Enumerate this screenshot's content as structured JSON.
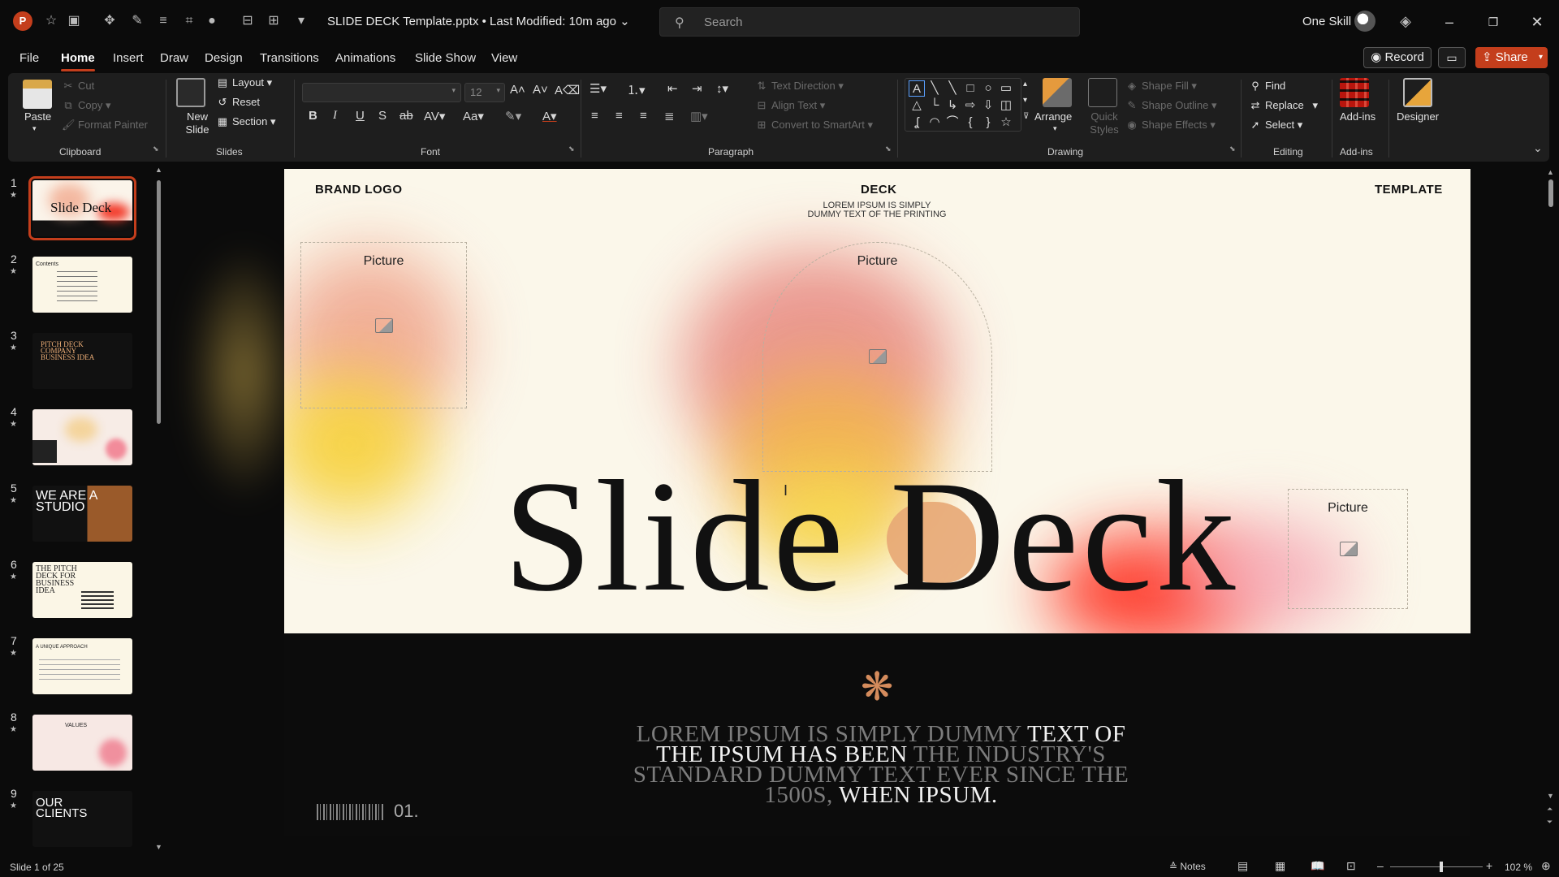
{
  "app": {
    "logo_letter": "P"
  },
  "titlebar": {
    "doc_title": "SLIDE DECK Template.pptx • Last Modified: 10m ago ⌄",
    "search_placeholder": "Search",
    "user_name": "One Skill"
  },
  "menu": {
    "tabs": [
      {
        "label": "File"
      },
      {
        "label": "Home"
      },
      {
        "label": "Insert"
      },
      {
        "label": "Draw"
      },
      {
        "label": "Design"
      },
      {
        "label": "Transitions"
      },
      {
        "label": "Animations"
      },
      {
        "label": "Slide Show"
      },
      {
        "label": "View"
      }
    ],
    "record_label": "Record",
    "share_label": "Share"
  },
  "ribbon": {
    "clipboard": {
      "label": "Clipboard",
      "paste": "Paste",
      "cut": "Cut",
      "copy": "Copy",
      "format_painter": "Format Painter"
    },
    "slides": {
      "label": "Slides",
      "new_slide": "New Slide",
      "layout": "Layout",
      "reset": "Reset",
      "section": "Section"
    },
    "font": {
      "label": "Font",
      "size": "12"
    },
    "paragraph": {
      "label": "Paragraph",
      "text_direction": "Text Direction",
      "align_text": "Align Text",
      "convert_smartart": "Convert to SmartArt"
    },
    "drawing": {
      "label": "Drawing",
      "arrange": "Arrange",
      "quick_styles": "Quick Styles",
      "shape_fill": "Shape Fill",
      "shape_outline": "Shape Outline",
      "shape_effects": "Shape Effects"
    },
    "editing": {
      "label": "Editing",
      "find": "Find",
      "replace": "Replace",
      "select": "Select"
    },
    "addins": {
      "label": "Add-ins",
      "addins_btn": "Add-ins",
      "designer": "Designer"
    }
  },
  "thumbnails": [
    {
      "num": "1",
      "title": "Slide Deck"
    },
    {
      "num": "2",
      "title": "Contents"
    },
    {
      "num": "3",
      "title": "PITCH DECK COMPANY BUSINESS IDEA"
    },
    {
      "num": "4",
      "title": ""
    },
    {
      "num": "5",
      "title": "WE ARE A STUDIO"
    },
    {
      "num": "6",
      "title": "THE PITCH DECK FOR BUSINESS IDEA"
    },
    {
      "num": "7",
      "title": "A UNIQUE APPROACH"
    },
    {
      "num": "8",
      "title": "VALUES"
    },
    {
      "num": "9",
      "title": "OUR CLIENTS"
    }
  ],
  "slide": {
    "brand_logo": "BRAND LOGO",
    "deck": "DECK",
    "deck_sub_1": "LOREM IPSUM IS SIMPLY",
    "deck_sub_2": "DUMMY TEXT OF THE PRINTING",
    "template": "TEMPLATE",
    "picture_label": "Picture",
    "title": "Slide Deck",
    "body_parts": [
      {
        "text": "LOREM IPSUM IS SIMPLY DUMMY ",
        "hl": false
      },
      {
        "text": "TEXT OF THE IPSUM HAS BEEN ",
        "hl": true
      },
      {
        "text": "THE INDUSTRY'S STANDARD DUMMY TEXT EVER SINCE THE 1500S, ",
        "hl": false
      },
      {
        "text": "WHEN IPSUM.",
        "hl": true
      }
    ],
    "number": "01."
  },
  "status": {
    "slide_info": "Slide 1 of 25",
    "notes": "Notes",
    "zoom": "102 %",
    "zoom_level": 0.55
  },
  "colors": {
    "accent": "#c43e1c",
    "slide_bg": "#fbf7ea",
    "slide_dark": "#0c0c0c"
  }
}
